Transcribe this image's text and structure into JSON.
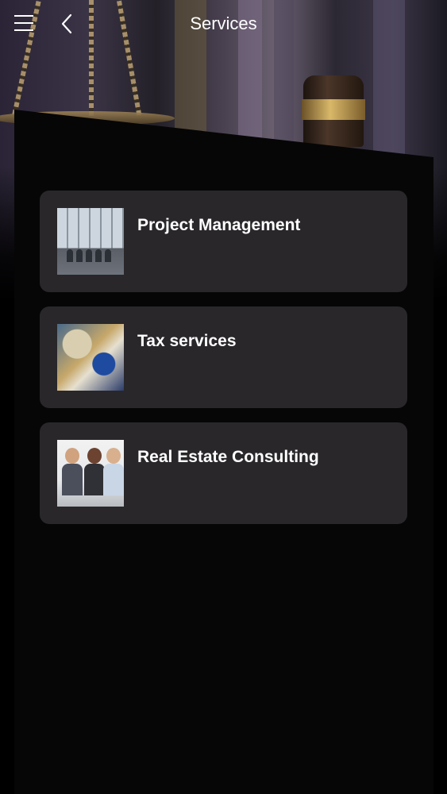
{
  "header": {
    "title": "Services",
    "menu_icon": "hamburger-menu-icon",
    "back_icon": "chevron-left-icon"
  },
  "services": [
    {
      "label": "Project Management",
      "thumbnail": "meeting-room-photo"
    },
    {
      "label": "Tax services",
      "thumbnail": "desk-papers-photo"
    },
    {
      "label": "Real Estate Consulting",
      "thumbnail": "business-people-photo"
    }
  ],
  "colors": {
    "background": "#000000",
    "card": "#29272a",
    "text": "#ffffff"
  }
}
